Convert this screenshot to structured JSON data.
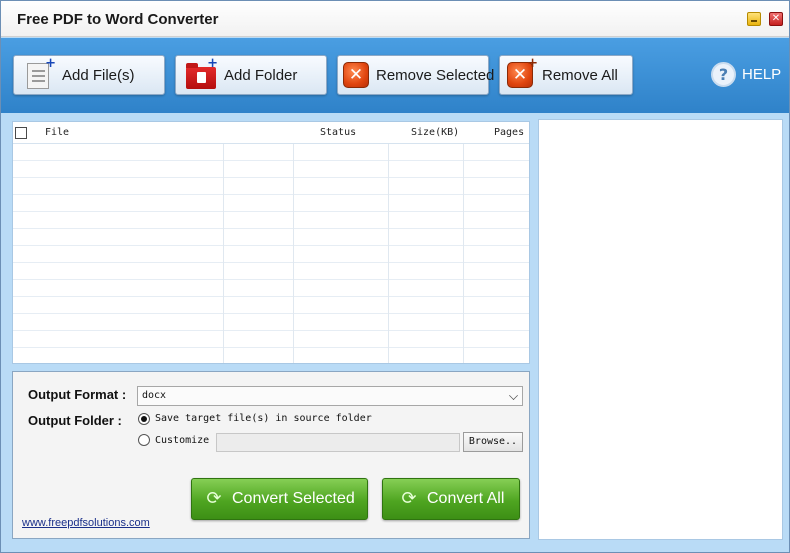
{
  "window": {
    "title": "Free PDF to Word Converter",
    "minimize_glyph": "",
    "close_glyph": "✕"
  },
  "toolbar": {
    "add_files": "Add File(s)",
    "add_folder": "Add Folder",
    "remove_selected": "Remove Selected",
    "remove_all": "Remove All",
    "help": "HELP",
    "help_glyph": "?"
  },
  "file_list": {
    "columns": [
      "File",
      "Status",
      "Size(KB)",
      "Pages"
    ],
    "rows": []
  },
  "settings": {
    "output_format_label": "Output Format :",
    "output_format_value": "docx",
    "output_folder_label": "Output Folder :",
    "save_in_source_label": "Save target file(s) in source folder",
    "save_in_source_selected": true,
    "customize_label": "Customize",
    "customize_path": "",
    "browse_label": "Browse.."
  },
  "actions": {
    "convert_selected": "Convert Selected",
    "convert_all": "Convert All"
  },
  "footer": {
    "website": "www.freepdfsolutions.com"
  },
  "colors": {
    "toolbar": "#3a8fd6",
    "convert_green": "#4fa521",
    "close_red": "#c41f1f",
    "minimize_yellow": "#e9b40f"
  },
  "icons": {
    "add_files": "document-plus-icon",
    "add_folder": "pdf-folder-plus-icon",
    "remove_selected": "remove-x-icon",
    "remove_all": "remove-all-x-icon",
    "help": "help-question-icon",
    "convert": "refresh-convert-icon"
  }
}
